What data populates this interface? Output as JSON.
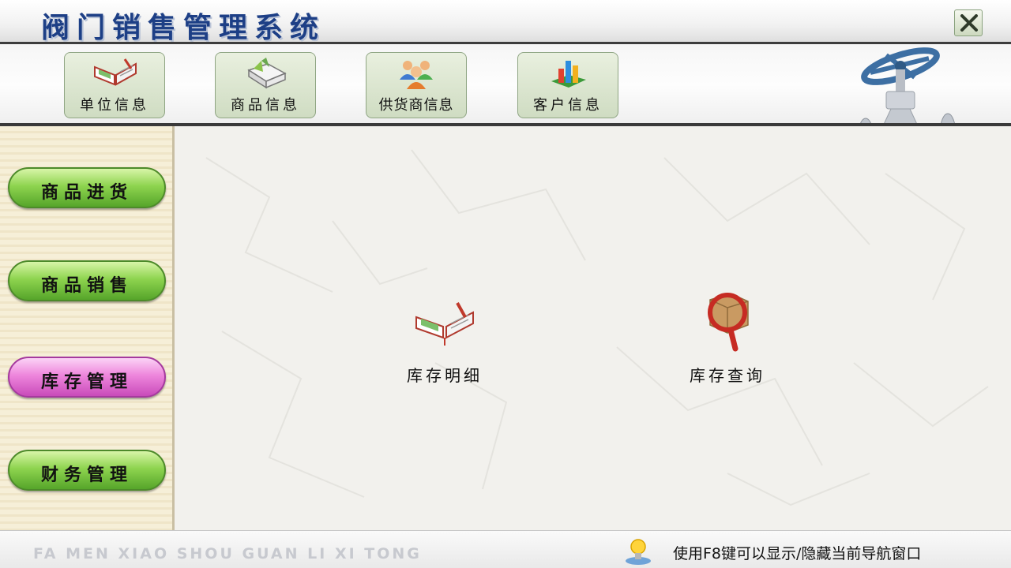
{
  "app": {
    "title": "阀门销售管理系统"
  },
  "window": {
    "close_icon": "close-x-icon"
  },
  "toolbar": {
    "buttons": [
      {
        "label": "单位信息",
        "icon": "open-book-icon"
      },
      {
        "label": "商品信息",
        "icon": "product-card-icon"
      },
      {
        "label": "供货商信息",
        "icon": "people-group-icon"
      },
      {
        "label": "客户信息",
        "icon": "bar-chart-icon"
      }
    ]
  },
  "sidebar": {
    "items": [
      {
        "label": "商品进货",
        "active": false
      },
      {
        "label": "商品销售",
        "active": false
      },
      {
        "label": "库存管理",
        "active": true
      },
      {
        "label": "财务管理",
        "active": false
      }
    ]
  },
  "main": {
    "functions": [
      {
        "label": "库存明细",
        "icon": "open-book-icon"
      },
      {
        "label": "库存查询",
        "icon": "magnifier-box-icon"
      }
    ]
  },
  "footer": {
    "slogan": "FA MEN XIAO SHOU GUAN LI XI TONG",
    "hint": "使用F8键可以显示/隐藏当前导航窗口",
    "hint_icon": "lightbulb-icon"
  },
  "colors": {
    "title_text": "#1d3f86",
    "sidebar_button": "#8ed44f",
    "sidebar_button_active": "#ee86dc"
  }
}
